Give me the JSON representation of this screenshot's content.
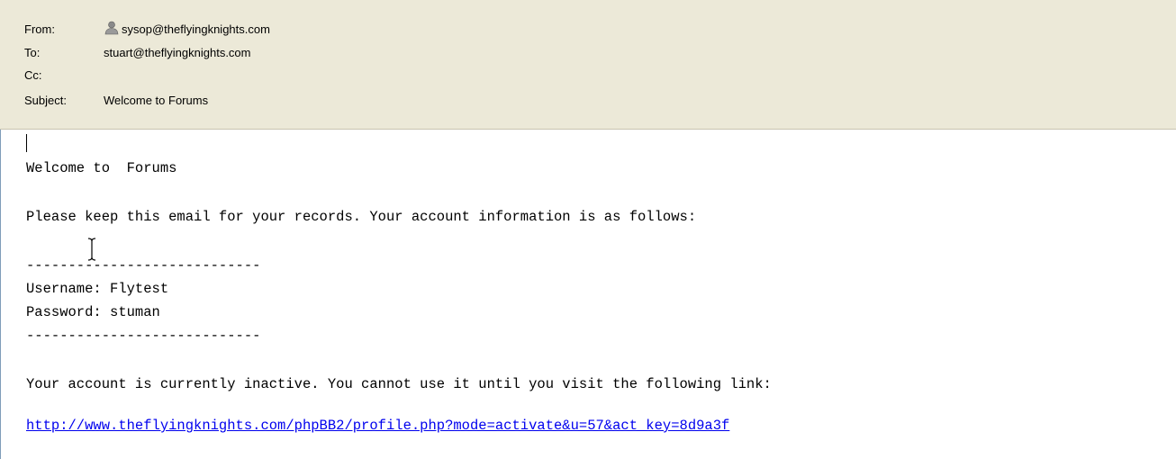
{
  "header": {
    "from_label": "From:",
    "from_value": "sysop@theflyingknights.com",
    "sender_icon": "contact-person-icon",
    "to_label": "To:",
    "to_value": "stuart@theflyingknights.com",
    "cc_label": "Cc:",
    "cc_value": "",
    "subject_label": "Subject:",
    "subject_value": "Welcome to  Forums"
  },
  "body": {
    "line_welcome": "Welcome to  Forums",
    "line_keep": "Please keep this email for your records. Your account information is as follows:",
    "separator_top": "----------------------------",
    "line_username": "Username: Flytest",
    "line_password": "Password: stuman",
    "separator_bottom": "----------------------------",
    "line_inactive": "Your account is currently inactive. You cannot use it until you visit the following link:",
    "activation_link": "http://www.theflyingknights.com/phpBB2/profile.php?mode=activate&u=57&act_key=8d9a3f"
  },
  "colors": {
    "header_bg": "#ece9d8",
    "link": "#0000ee",
    "body_border": "#7f9db9"
  }
}
